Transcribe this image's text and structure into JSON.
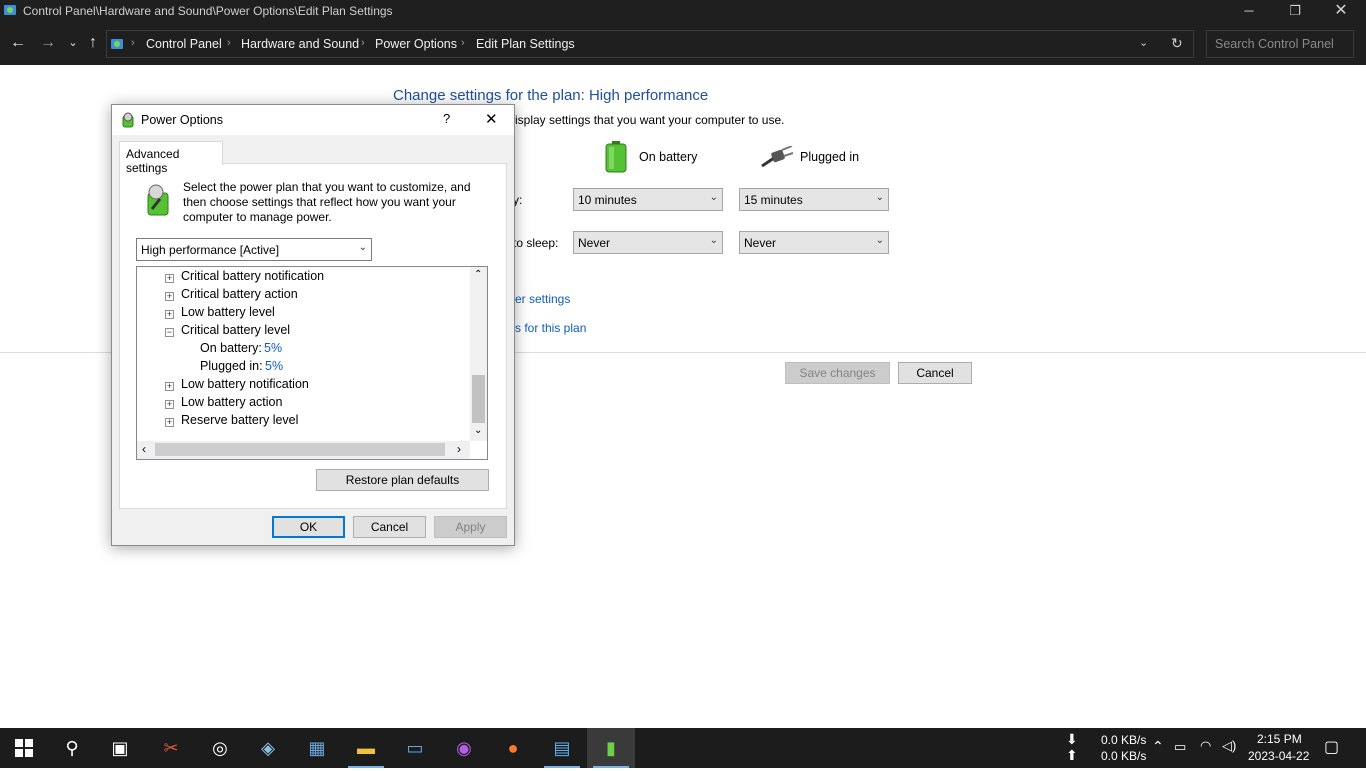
{
  "window": {
    "title": "Control Panel\\Hardware and Sound\\Power Options\\Edit Plan Settings",
    "minimize_icon": "minimize-icon",
    "restore_icon": "restore-icon",
    "close_icon": "close-icon"
  },
  "address_bar": {
    "breadcrumbs": [
      "Control Panel",
      "Hardware and Sound",
      "Power Options",
      "Edit Plan Settings"
    ],
    "search_placeholder": "Search Control Panel"
  },
  "main": {
    "heading": "Change settings for the plan: High performance",
    "subtext_visible": "isplay settings that you want your computer to use.",
    "col_battery": "On battery",
    "col_plugged": "Plugged in",
    "row1_label_visible": "y:",
    "row1_battery": "10 minutes",
    "row1_plugged": "15 minutes",
    "row2_label_visible": "to sleep:",
    "row2_battery": "Never",
    "row2_plugged": "Never",
    "link1_visible": "er settings",
    "link2_visible": "s for this plan",
    "save_label": "Save changes",
    "cancel_label": "Cancel"
  },
  "dialog": {
    "title": "Power Options",
    "help": "?",
    "tab": "Advanced settings",
    "description": "Select the power plan that you want to customize, and then choose settings that reflect how you want your computer to manage power.",
    "plan_selected": "High performance [Active]",
    "tree": [
      {
        "label": "Critical battery notification",
        "state": "+"
      },
      {
        "label": "Critical battery action",
        "state": "+"
      },
      {
        "label": "Low battery level",
        "state": "+"
      },
      {
        "label": "Critical battery level",
        "state": "−"
      },
      {
        "label": "On battery:",
        "value": "5%"
      },
      {
        "label": "Plugged in:",
        "value": "5%"
      },
      {
        "label": "Low battery notification",
        "state": "+"
      },
      {
        "label": "Low battery action",
        "state": "+"
      },
      {
        "label": "Reserve battery level",
        "state": "+"
      }
    ],
    "restore_label": "Restore plan defaults",
    "ok_label": "OK",
    "cancel_label": "Cancel",
    "apply_label": "Apply"
  },
  "taskbar": {
    "net_down": "0.0 KB/s",
    "net_up": "0.0 KB/s",
    "time": "2:15 PM",
    "date": "2023-04-22"
  },
  "colors": {
    "accent": "#0078d7",
    "link": "#0f5cbf",
    "titlebar": "#1f1f1f",
    "taskbar": "#1c1c1c"
  }
}
